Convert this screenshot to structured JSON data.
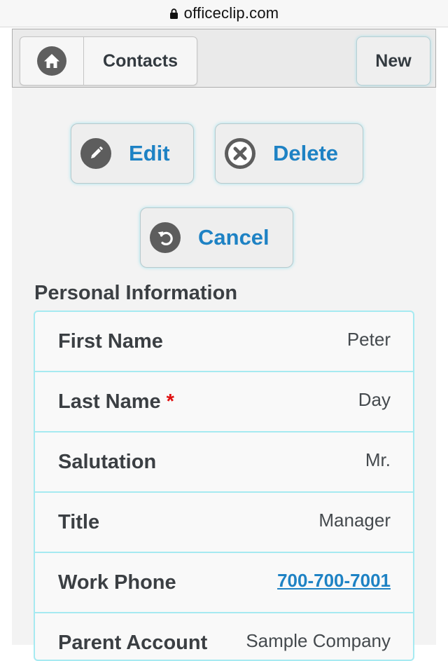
{
  "browser": {
    "url": "officeclip.com"
  },
  "toolbar": {
    "contacts_label": "Contacts",
    "new_label": "New"
  },
  "actions": {
    "edit_label": "Edit",
    "delete_label": "Delete",
    "cancel_label": "Cancel"
  },
  "section": {
    "title": "Personal Information"
  },
  "fields": [
    {
      "label": "First Name",
      "value": "Peter"
    },
    {
      "label": "Last Name",
      "value": "Day",
      "required_mark": "*"
    },
    {
      "label": "Salutation",
      "value": "Mr."
    },
    {
      "label": "Title",
      "value": "Manager"
    },
    {
      "label": "Work Phone",
      "value": "700-700-7001"
    },
    {
      "label": "Parent Account",
      "value": "Sample Company"
    }
  ],
  "colors": {
    "accent": "#1e82c4",
    "border_cyan": "#a6eaf1",
    "required": "#e01010",
    "icon_bg": "#5d5d5d"
  },
  "icons": {
    "home": "home-icon",
    "edit": "pencil-icon",
    "delete": "close-circle-icon",
    "cancel": "undo-icon",
    "lock": "lock-icon"
  }
}
